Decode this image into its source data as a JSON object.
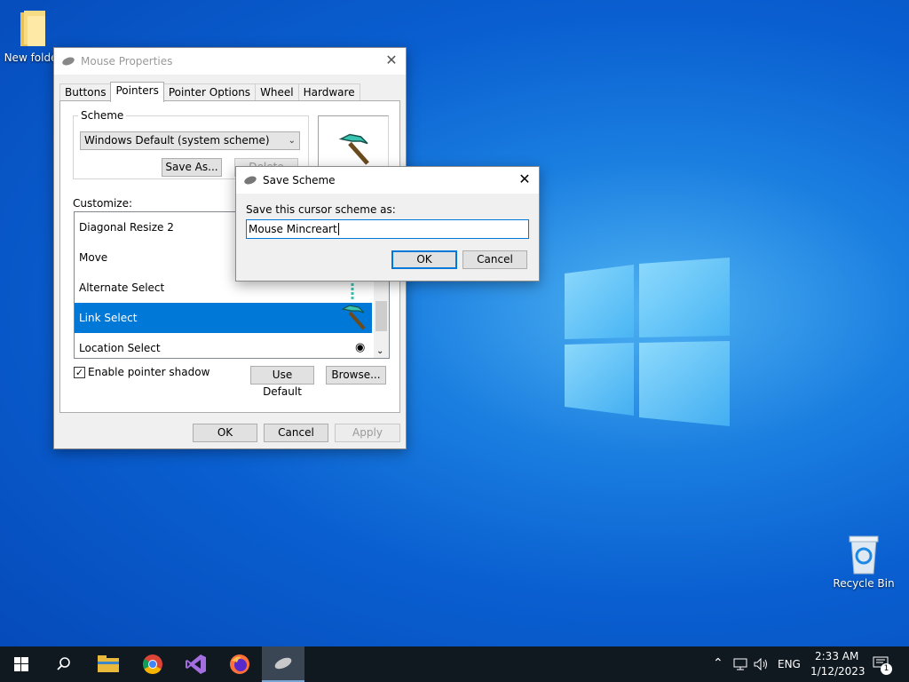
{
  "desktop": {
    "icons": [
      {
        "label": "New folder"
      },
      {
        "label": "Recycle Bin"
      }
    ]
  },
  "mouse_properties": {
    "title": "Mouse Properties",
    "tabs": [
      "Buttons",
      "Pointers",
      "Pointer Options",
      "Wheel",
      "Hardware"
    ],
    "active_tab": "Pointers",
    "scheme_label": "Scheme",
    "scheme_value": "Windows Default (system scheme)",
    "save_as_label": "Save As...",
    "delete_label": "Delete",
    "customize_label": "Customize:",
    "cursor_items": [
      {
        "label": "Diagonal Resize 2"
      },
      {
        "label": "Move"
      },
      {
        "label": "Alternate Select"
      },
      {
        "label": "Link Select"
      },
      {
        "label": "Location Select"
      }
    ],
    "selected_item": "Link Select",
    "enable_shadow_label": "Enable pointer shadow",
    "enable_shadow_checked": true,
    "use_default_label": "Use Default",
    "browse_label": "Browse...",
    "ok_label": "OK",
    "cancel_label": "Cancel",
    "apply_label": "Apply"
  },
  "save_scheme": {
    "title": "Save Scheme",
    "prompt": "Save this cursor scheme as:",
    "input_value": "Mouse Mincreart",
    "ok_label": "OK",
    "cancel_label": "Cancel"
  },
  "taskbar": {
    "lang": "ENG",
    "time": "2:33 AM",
    "date": "1/12/2023",
    "notification_count": "1",
    "pinned": [
      "start-icon",
      "search-icon",
      "file-explorer-icon",
      "chrome-icon",
      "visual-studio-icon",
      "firefox-icon",
      "mouse-icon"
    ]
  },
  "colors": {
    "accent": "#0078d7",
    "desktop": "#0a5fd0",
    "taskbar": "#101820"
  }
}
